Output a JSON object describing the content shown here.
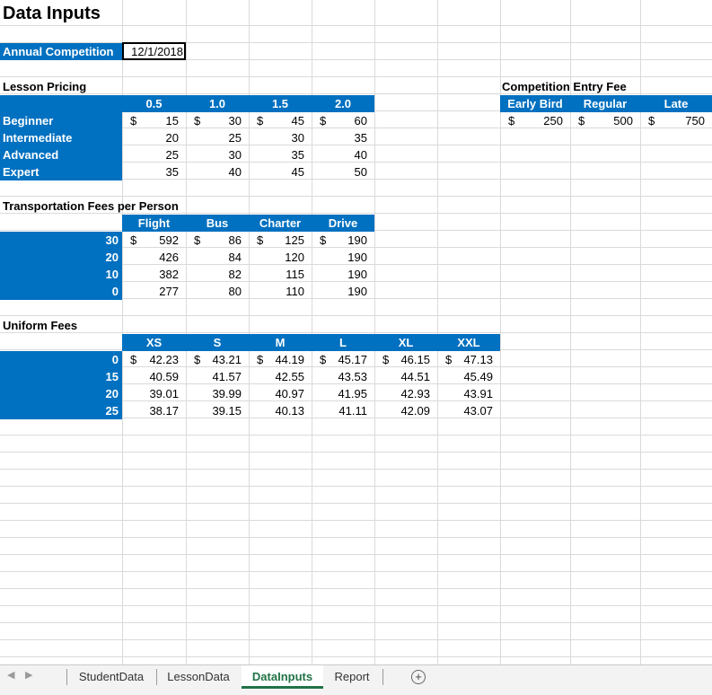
{
  "title": "Data Inputs",
  "annual_competition": {
    "label": "Annual Competition",
    "date": "12/1/2018"
  },
  "lesson_pricing": {
    "heading": "Lesson Pricing",
    "columns": [
      "0.5",
      "1.0",
      "1.5",
      "2.0"
    ],
    "rows": [
      {
        "label": "Beginner",
        "cells": [
          {
            "cur": "$",
            "v": "15"
          },
          {
            "cur": "$",
            "v": "30"
          },
          {
            "cur": "$",
            "v": "45"
          },
          {
            "cur": "$",
            "v": "60"
          }
        ]
      },
      {
        "label": "Intermediate",
        "cells": [
          {
            "cur": "",
            "v": "20"
          },
          {
            "cur": "",
            "v": "25"
          },
          {
            "cur": "",
            "v": "30"
          },
          {
            "cur": "",
            "v": "35"
          }
        ]
      },
      {
        "label": "Advanced",
        "cells": [
          {
            "cur": "",
            "v": "25"
          },
          {
            "cur": "",
            "v": "30"
          },
          {
            "cur": "",
            "v": "35"
          },
          {
            "cur": "",
            "v": "40"
          }
        ]
      },
      {
        "label": "Expert",
        "cells": [
          {
            "cur": "",
            "v": "35"
          },
          {
            "cur": "",
            "v": "40"
          },
          {
            "cur": "",
            "v": "45"
          },
          {
            "cur": "",
            "v": "50"
          }
        ]
      }
    ]
  },
  "entry_fee": {
    "heading": "Competition Entry Fee",
    "columns": [
      "Early Bird",
      "Regular",
      "Late"
    ],
    "cells": [
      {
        "cur": "$",
        "v": "250"
      },
      {
        "cur": "$",
        "v": "500"
      },
      {
        "cur": "$",
        "v": "750"
      }
    ]
  },
  "transportation": {
    "heading": "Transportation Fees per Person",
    "columns": [
      "Flight",
      "Bus",
      "Charter",
      "Drive"
    ],
    "rows": [
      {
        "label": "30",
        "cells": [
          {
            "cur": "$",
            "v": "592"
          },
          {
            "cur": "$",
            "v": "86"
          },
          {
            "cur": "$",
            "v": "125"
          },
          {
            "cur": "$",
            "v": "190"
          }
        ]
      },
      {
        "label": "20",
        "cells": [
          {
            "cur": "",
            "v": "426"
          },
          {
            "cur": "",
            "v": "84"
          },
          {
            "cur": "",
            "v": "120"
          },
          {
            "cur": "",
            "v": "190"
          }
        ]
      },
      {
        "label": "10",
        "cells": [
          {
            "cur": "",
            "v": "382"
          },
          {
            "cur": "",
            "v": "82"
          },
          {
            "cur": "",
            "v": "115"
          },
          {
            "cur": "",
            "v": "190"
          }
        ]
      },
      {
        "label": "0",
        "cells": [
          {
            "cur": "",
            "v": "277"
          },
          {
            "cur": "",
            "v": "80"
          },
          {
            "cur": "",
            "v": "110"
          },
          {
            "cur": "",
            "v": "190"
          }
        ]
      }
    ]
  },
  "uniform": {
    "heading": "Uniform Fees",
    "columns": [
      "XS",
      "S",
      "M",
      "L",
      "XL",
      "XXL"
    ],
    "rows": [
      {
        "label": "0",
        "cells": [
          {
            "cur": "$",
            "v": "42.23"
          },
          {
            "cur": "$",
            "v": "43.21"
          },
          {
            "cur": "$",
            "v": "44.19"
          },
          {
            "cur": "$",
            "v": "45.17"
          },
          {
            "cur": "$",
            "v": "46.15"
          },
          {
            "cur": "$",
            "v": "47.13"
          }
        ]
      },
      {
        "label": "15",
        "cells": [
          {
            "cur": "",
            "v": "40.59"
          },
          {
            "cur": "",
            "v": "41.57"
          },
          {
            "cur": "",
            "v": "42.55"
          },
          {
            "cur": "",
            "v": "43.53"
          },
          {
            "cur": "",
            "v": "44.51"
          },
          {
            "cur": "",
            "v": "45.49"
          }
        ]
      },
      {
        "label": "20",
        "cells": [
          {
            "cur": "",
            "v": "39.01"
          },
          {
            "cur": "",
            "v": "39.99"
          },
          {
            "cur": "",
            "v": "40.97"
          },
          {
            "cur": "",
            "v": "41.95"
          },
          {
            "cur": "",
            "v": "42.93"
          },
          {
            "cur": "",
            "v": "43.91"
          }
        ]
      },
      {
        "label": "25",
        "cells": [
          {
            "cur": "",
            "v": "38.17"
          },
          {
            "cur": "",
            "v": "39.15"
          },
          {
            "cur": "",
            "v": "40.13"
          },
          {
            "cur": "",
            "v": "41.11"
          },
          {
            "cur": "",
            "v": "42.09"
          },
          {
            "cur": "",
            "v": "43.07"
          }
        ]
      }
    ]
  },
  "tabs": [
    {
      "label": "StudentData",
      "active": false
    },
    {
      "label": "LessonData",
      "active": false
    },
    {
      "label": "DataInputs",
      "active": true
    },
    {
      "label": "Report",
      "active": false
    }
  ],
  "add_sheet_icon": "plus-circle-icon",
  "colors": {
    "header_fill": "#0070c0",
    "active_tab": "#217346"
  }
}
